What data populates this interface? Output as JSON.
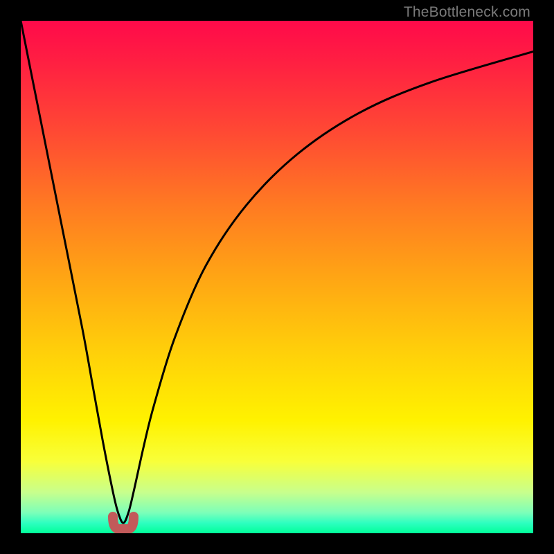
{
  "watermark": "TheBottleneck.com",
  "chart_data": {
    "type": "line",
    "title": "",
    "xlabel": "",
    "ylabel": "",
    "ylim": [
      0,
      100
    ],
    "xlim": [
      0,
      100
    ],
    "x": [
      0,
      4,
      8,
      12,
      14,
      16,
      18,
      19,
      20,
      21,
      22,
      24,
      26,
      30,
      36,
      44,
      54,
      66,
      80,
      100
    ],
    "values": [
      100,
      80,
      60,
      40,
      29,
      18,
      8,
      4,
      2,
      4,
      8,
      17,
      25,
      38,
      52,
      64,
      74,
      82,
      88,
      94
    ],
    "notch": {
      "x_center": 20,
      "width": 3,
      "color": "#c25a5a"
    },
    "background_gradient": [
      "#ff0a4a",
      "#ff7a22",
      "#fff200",
      "#00ff99"
    ]
  }
}
